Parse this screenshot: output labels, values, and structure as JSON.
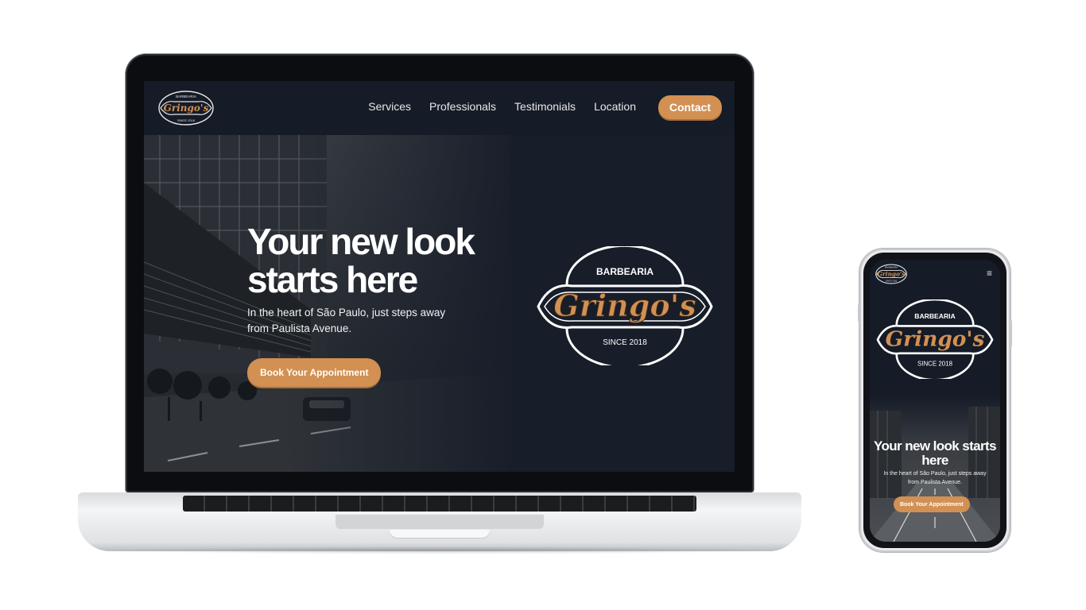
{
  "brand": {
    "logo_top": "BARBEARIA",
    "logo_name": "Gringo's",
    "logo_bottom": "SINCE 2018",
    "accent": "#d29052",
    "background": "#151b27"
  },
  "nav": {
    "items": [
      "Services",
      "Professionals",
      "Testimonials",
      "Location"
    ],
    "contact_label": "Contact"
  },
  "hero": {
    "title": "Your new look starts here",
    "subtitle": "In the heart of São Paulo, just steps away from Paulista Avenue.",
    "cta_label": "Book Your Appointment"
  },
  "mobile": {
    "menu_icon": "hamburger-icon",
    "menu_glyph": "≡"
  }
}
